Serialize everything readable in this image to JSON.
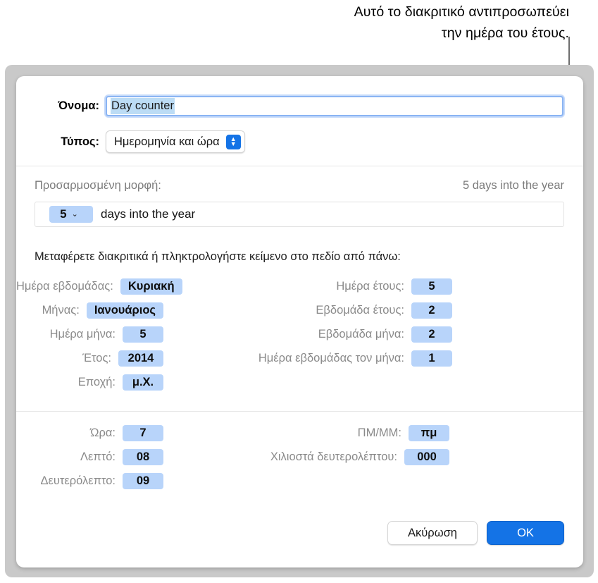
{
  "callout": {
    "line1": "Αυτό το διακριτικό αντιπροσωπεύει",
    "line2": "την ημέρα του έτους."
  },
  "colors": {
    "token_bg": "#b8d4fa",
    "accent_blue": "#1473e6",
    "selection_blue": "#bcdcf5",
    "label_gray": "#8a8a8a",
    "leader_line": "#6e6e6e"
  },
  "dialog": {
    "name": {
      "label": "Όνομα:",
      "value": "Day counter",
      "placeholder": "Όνομα"
    },
    "type": {
      "label": "Τύπος:",
      "value": "Ημερομηνία και ώρα",
      "options": [
        "Ημερομηνία και ώρα"
      ]
    },
    "custom_format": {
      "label": "Προσαρμοσμένη μορφή:",
      "preview": "5 days into the year",
      "token_value": "5",
      "token_caret": "⌄",
      "trailing_text": "days into the year"
    },
    "instruction": "Μεταφέρετε διακριτικά ή πληκτρολογήστε κείμενο στο πεδίο από πάνω:",
    "date_tokens_left": [
      {
        "label": "Ημέρα εβδομάδας:",
        "value": "Κυριακή"
      },
      {
        "label": "Μήνας:",
        "value": "Ιανουάριος"
      },
      {
        "label": "Ημέρα μήνα:",
        "value": "5"
      },
      {
        "label": "Έτος:",
        "value": "2014"
      },
      {
        "label": "Εποχή:",
        "value": "μ.Χ."
      }
    ],
    "date_tokens_right": [
      {
        "label": "Ημέρα έτους:",
        "value": "5"
      },
      {
        "label": "Εβδομάδα έτους:",
        "value": "2"
      },
      {
        "label": "Εβδομάδα μήνα:",
        "value": "2"
      },
      {
        "label": "Ημέρα εβδομάδας τον μήνα:",
        "value": "1"
      }
    ],
    "time_tokens_left": [
      {
        "label": "Ώρα:",
        "value": "7"
      },
      {
        "label": "Λεπτό:",
        "value": "08"
      },
      {
        "label": "Δευτερόλεπτο:",
        "value": "09"
      }
    ],
    "time_tokens_right": [
      {
        "label": "ΠΜ/ΜΜ:",
        "value": "πμ"
      },
      {
        "label": "Χιλιοστά δευτερολέπτου:",
        "value": "000"
      }
    ],
    "buttons": {
      "cancel": "Ακύρωση",
      "ok": "OK"
    }
  }
}
